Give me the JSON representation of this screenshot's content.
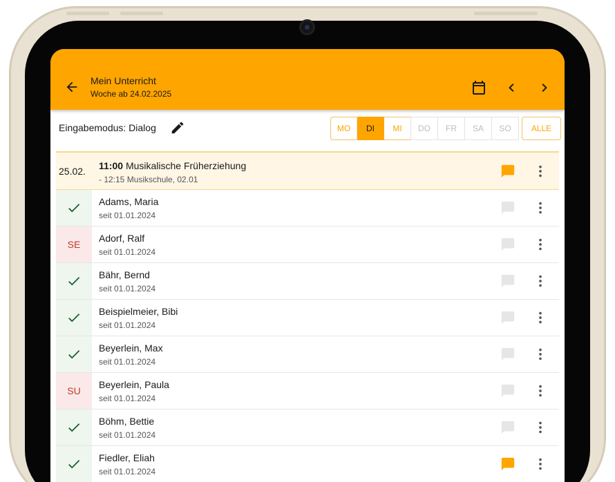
{
  "appbar": {
    "title": "Mein Unterricht",
    "subtitle": "Woche ab 24.02.2025",
    "back_icon": "arrow-back-icon",
    "calendar_icon": "calendar-icon",
    "prev_icon": "chevron-left-icon",
    "next_icon": "chevron-right-icon"
  },
  "mode": {
    "label": "Eingabemodus: Dialog",
    "edit_icon": "pencil-icon"
  },
  "days": [
    {
      "label": "MO",
      "state": "active"
    },
    {
      "label": "DI",
      "state": "selected"
    },
    {
      "label": "MI",
      "state": "active"
    },
    {
      "label": "DO",
      "state": "inactive"
    },
    {
      "label": "FR",
      "state": "inactive"
    },
    {
      "label": "SA",
      "state": "inactive"
    },
    {
      "label": "SO",
      "state": "inactive"
    }
  ],
  "all_label": "ALLE",
  "lesson": {
    "date": "25.02.",
    "time": "11:00",
    "title": "Musikalische Früherziehung",
    "detail": "- 12:15 Musikschule, 02.01",
    "has_comment": true
  },
  "students": [
    {
      "name": "Adams, Maria",
      "since": "seit 01.01.2024",
      "status": "check",
      "has_comment": false
    },
    {
      "name": "Adorf, Ralf",
      "since": "seit 01.01.2024",
      "status": "SE",
      "has_comment": false
    },
    {
      "name": "Bähr, Bernd",
      "since": "seit 01.01.2024",
      "status": "check",
      "has_comment": false
    },
    {
      "name": "Beispielmeier, Bibi",
      "since": "seit 01.01.2024",
      "status": "check",
      "has_comment": false
    },
    {
      "name": "Beyerlein, Max",
      "since": "seit 01.01.2024",
      "status": "check",
      "has_comment": false
    },
    {
      "name": "Beyerlein, Paula",
      "since": "seit 01.01.2024",
      "status": "SU",
      "has_comment": false
    },
    {
      "name": "Böhm, Bettie",
      "since": "seit 01.01.2024",
      "status": "check",
      "has_comment": false
    },
    {
      "name": "Fiedler, Eliah",
      "since": "seit 01.01.2024",
      "status": "check",
      "has_comment": true
    }
  ],
  "colors": {
    "accent": "#ffa500",
    "present_bg": "#eef6ee",
    "present_check": "#1e5e2a",
    "absent_bg": "#fbe9e9",
    "absent_text": "#c0392b",
    "comment_active": "#ffa500",
    "comment_inactive": "#e6e6e6"
  }
}
